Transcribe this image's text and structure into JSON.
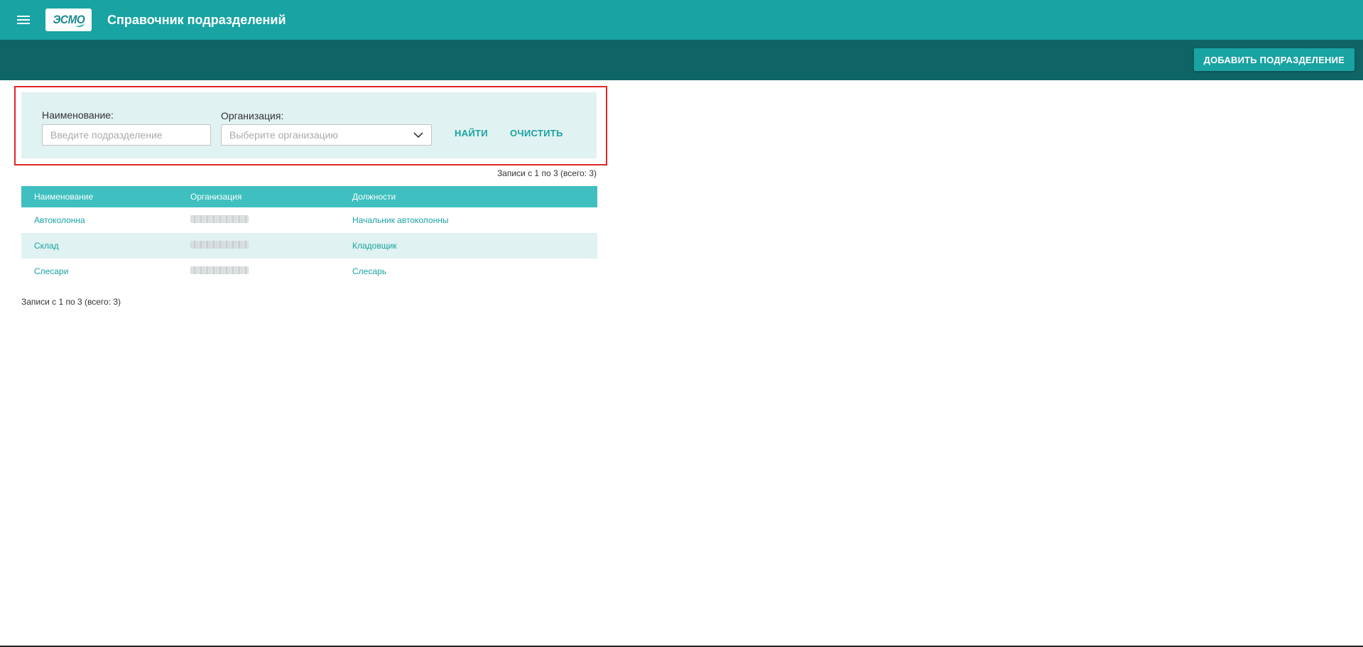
{
  "header": {
    "logo_text": "ЭСМО",
    "title": "Справочник подразделений"
  },
  "toolbar": {
    "add_label": "ДОБАВИТЬ ПОДРАЗДЕЛЕНИЕ"
  },
  "filter": {
    "name_label": "Наименование:",
    "name_placeholder": "Введите подразделение",
    "name_value": "",
    "org_label": "Организация:",
    "org_placeholder": "Выберите организацию",
    "find_label": "НАЙТИ",
    "clear_label": "ОЧИСТИТЬ"
  },
  "records_text": "Записи с 1 по 3 (всего: 3)",
  "table": {
    "columns": [
      "Наименование",
      "Организация",
      "Должности"
    ],
    "rows": [
      {
        "name": "Автоколонна",
        "position": "Начальник автоколонны"
      },
      {
        "name": "Склад",
        "position": "Кладовщик"
      },
      {
        "name": "Слесари",
        "position": "Слесарь"
      }
    ]
  },
  "colors": {
    "primary": "#19a3a3",
    "primary_dark": "#0f6565",
    "table_header": "#3fbfbf",
    "panel_bg": "#e0f2f1",
    "highlight": "#e02626"
  },
  "icons": {
    "menu": "menu-icon",
    "dropdown": "chevron-down-icon"
  }
}
